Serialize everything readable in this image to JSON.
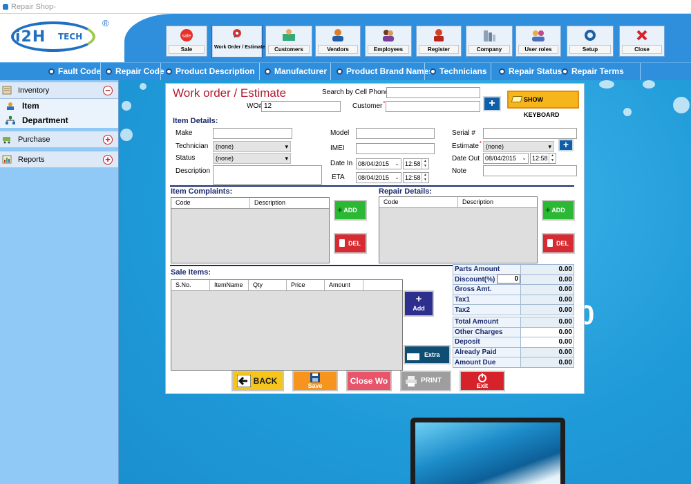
{
  "window": {
    "title": "Repair Shop-"
  },
  "logo": {
    "text_main": "i2H",
    "text_sub": "TECH",
    "reg": "®"
  },
  "toolbar": [
    {
      "label": "Sale",
      "icon": "sale-icon"
    },
    {
      "label": "Work Order / Estimate",
      "icon": "work-order-icon"
    },
    {
      "label": "Customers",
      "icon": "customers-icon"
    },
    {
      "label": "Vendors",
      "icon": "vendors-icon"
    },
    {
      "label": "Employees",
      "icon": "employees-icon"
    },
    {
      "label": "Register",
      "icon": "register-icon"
    },
    {
      "label": "Company",
      "icon": "company-icon"
    },
    {
      "label": "User roles",
      "icon": "user-roles-icon"
    },
    {
      "label": "Setup",
      "icon": "setup-gear-icon"
    },
    {
      "label": "Close",
      "icon": "close-x-icon"
    }
  ],
  "nav": [
    "Fault Code",
    "Repair Code",
    "Product  Description",
    "Manufacturer",
    "Product Brand Names",
    "Technicians",
    "Repair Status",
    "Repair Terms"
  ],
  "sidebar": {
    "inventory": "Inventory",
    "item": "Item",
    "department": "Department",
    "purchase": "Purchase",
    "reports": "Reports",
    "minus": "−",
    "plus": "+"
  },
  "form": {
    "title": "Work order / Estimate",
    "search_label": "Search by Cell Phone",
    "search_value": "",
    "wo_label": "WO#",
    "wo_value": "12",
    "customer_label": "Customer",
    "customer_value": "",
    "show_keyboard": "SHOW KEYBOARD",
    "item_details": "Item Details:",
    "make": "Make",
    "technician": "Technician",
    "technician_value": "(none)",
    "status": "Status",
    "status_value": "(none)",
    "description": "Description",
    "model": "Model",
    "imei": "IMEI",
    "date_in": "Date In",
    "date_in_value": "08/04/2015",
    "time_in_value": "12:58",
    "eta": "ETA",
    "eta_value": "08/04/2015",
    "eta_time_value": "12:58",
    "serial": "Serial #",
    "estimate": "Estimate",
    "estimate_value": "(none)",
    "date_out": "Date Out",
    "date_out_value": "08/04/2015",
    "date_out_time_value": "12:58",
    "note": "Note",
    "plus": "+"
  },
  "complaints": {
    "title": "Item Complaints:",
    "columns": [
      "Code",
      "Description"
    ],
    "add": "ADD",
    "del": "DEL"
  },
  "repairs": {
    "title": "Repair Details:",
    "columns": [
      "Code",
      "Description"
    ],
    "add": "ADD",
    "del": "DEL"
  },
  "sale_items": {
    "title": "Sale Items:",
    "columns": [
      "S.No.",
      "ItemName",
      "Qty",
      "Price",
      "Amount"
    ],
    "add_label": "Add",
    "extra_label": "Extra"
  },
  "amounts": [
    {
      "label": "Parts Amount",
      "value": "0.00"
    },
    {
      "label": "Discount(%)",
      "value": "0.00",
      "input": "0"
    },
    {
      "label": "Gross Amt.",
      "value": "0.00"
    },
    {
      "label": "Tax1",
      "value": "0.00"
    },
    {
      "label": "Tax2",
      "value": "0.00"
    },
    {
      "label": "Total Amount",
      "value": "0.00"
    },
    {
      "label": "Other Charges",
      "value": "0.00"
    },
    {
      "label": "Deposit",
      "value": "0.00"
    },
    {
      "label": "Already Paid",
      "value": "0.00"
    },
    {
      "label": "Amount Due",
      "value": "0.00"
    }
  ],
  "buttons": {
    "back": "BACK",
    "save": "Save",
    "close_wo": "Close Wo",
    "print": "PRINT",
    "exit": "Exit"
  },
  "colors": {
    "accent_blue": "#2f8fdd",
    "title_red": "#b01c2e",
    "add_green": "#2bb934",
    "del_red": "#d72b34",
    "back_yellow": "#f6c51b",
    "save_orange": "#f7941d",
    "close_pink": "#e8546a",
    "print_gray": "#9e9e9e",
    "exit_red": "#d8222a"
  },
  "background": {
    "bigo": "0"
  }
}
